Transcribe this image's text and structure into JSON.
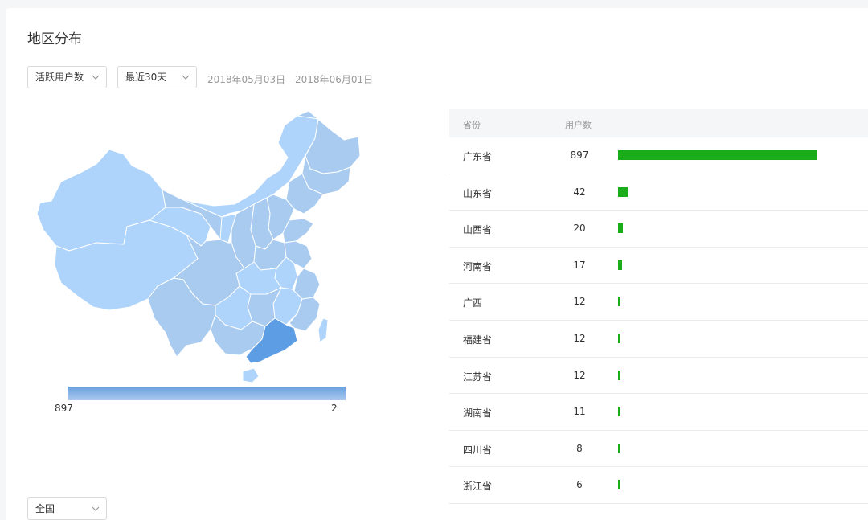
{
  "title": "地区分布",
  "filters": {
    "metric": "活跃用户数",
    "period": "最近30天",
    "date_range": "2018年05月03日 - 2018年06月01日",
    "region": "全国"
  },
  "legend": {
    "max_label": "897",
    "min_label": "2"
  },
  "colors": {
    "bar": "#1aad19",
    "map_base": "#aed4fb",
    "map_mid": "#a9cbf0",
    "map_highlight": "#5d9de3"
  },
  "table": {
    "headers": {
      "province": "省份",
      "users": "用户数"
    },
    "rows": [
      {
        "province": "广东省",
        "users": "897",
        "value": 897
      },
      {
        "province": "山东省",
        "users": "42",
        "value": 42
      },
      {
        "province": "山西省",
        "users": "20",
        "value": 20
      },
      {
        "province": "河南省",
        "users": "17",
        "value": 17
      },
      {
        "province": "广西",
        "users": "12",
        "value": 12
      },
      {
        "province": "福建省",
        "users": "12",
        "value": 12
      },
      {
        "province": "江苏省",
        "users": "12",
        "value": 12
      },
      {
        "province": "湖南省",
        "users": "11",
        "value": 11
      },
      {
        "province": "四川省",
        "users": "8",
        "value": 8
      },
      {
        "province": "浙江省",
        "users": "6",
        "value": 6
      }
    ]
  }
}
